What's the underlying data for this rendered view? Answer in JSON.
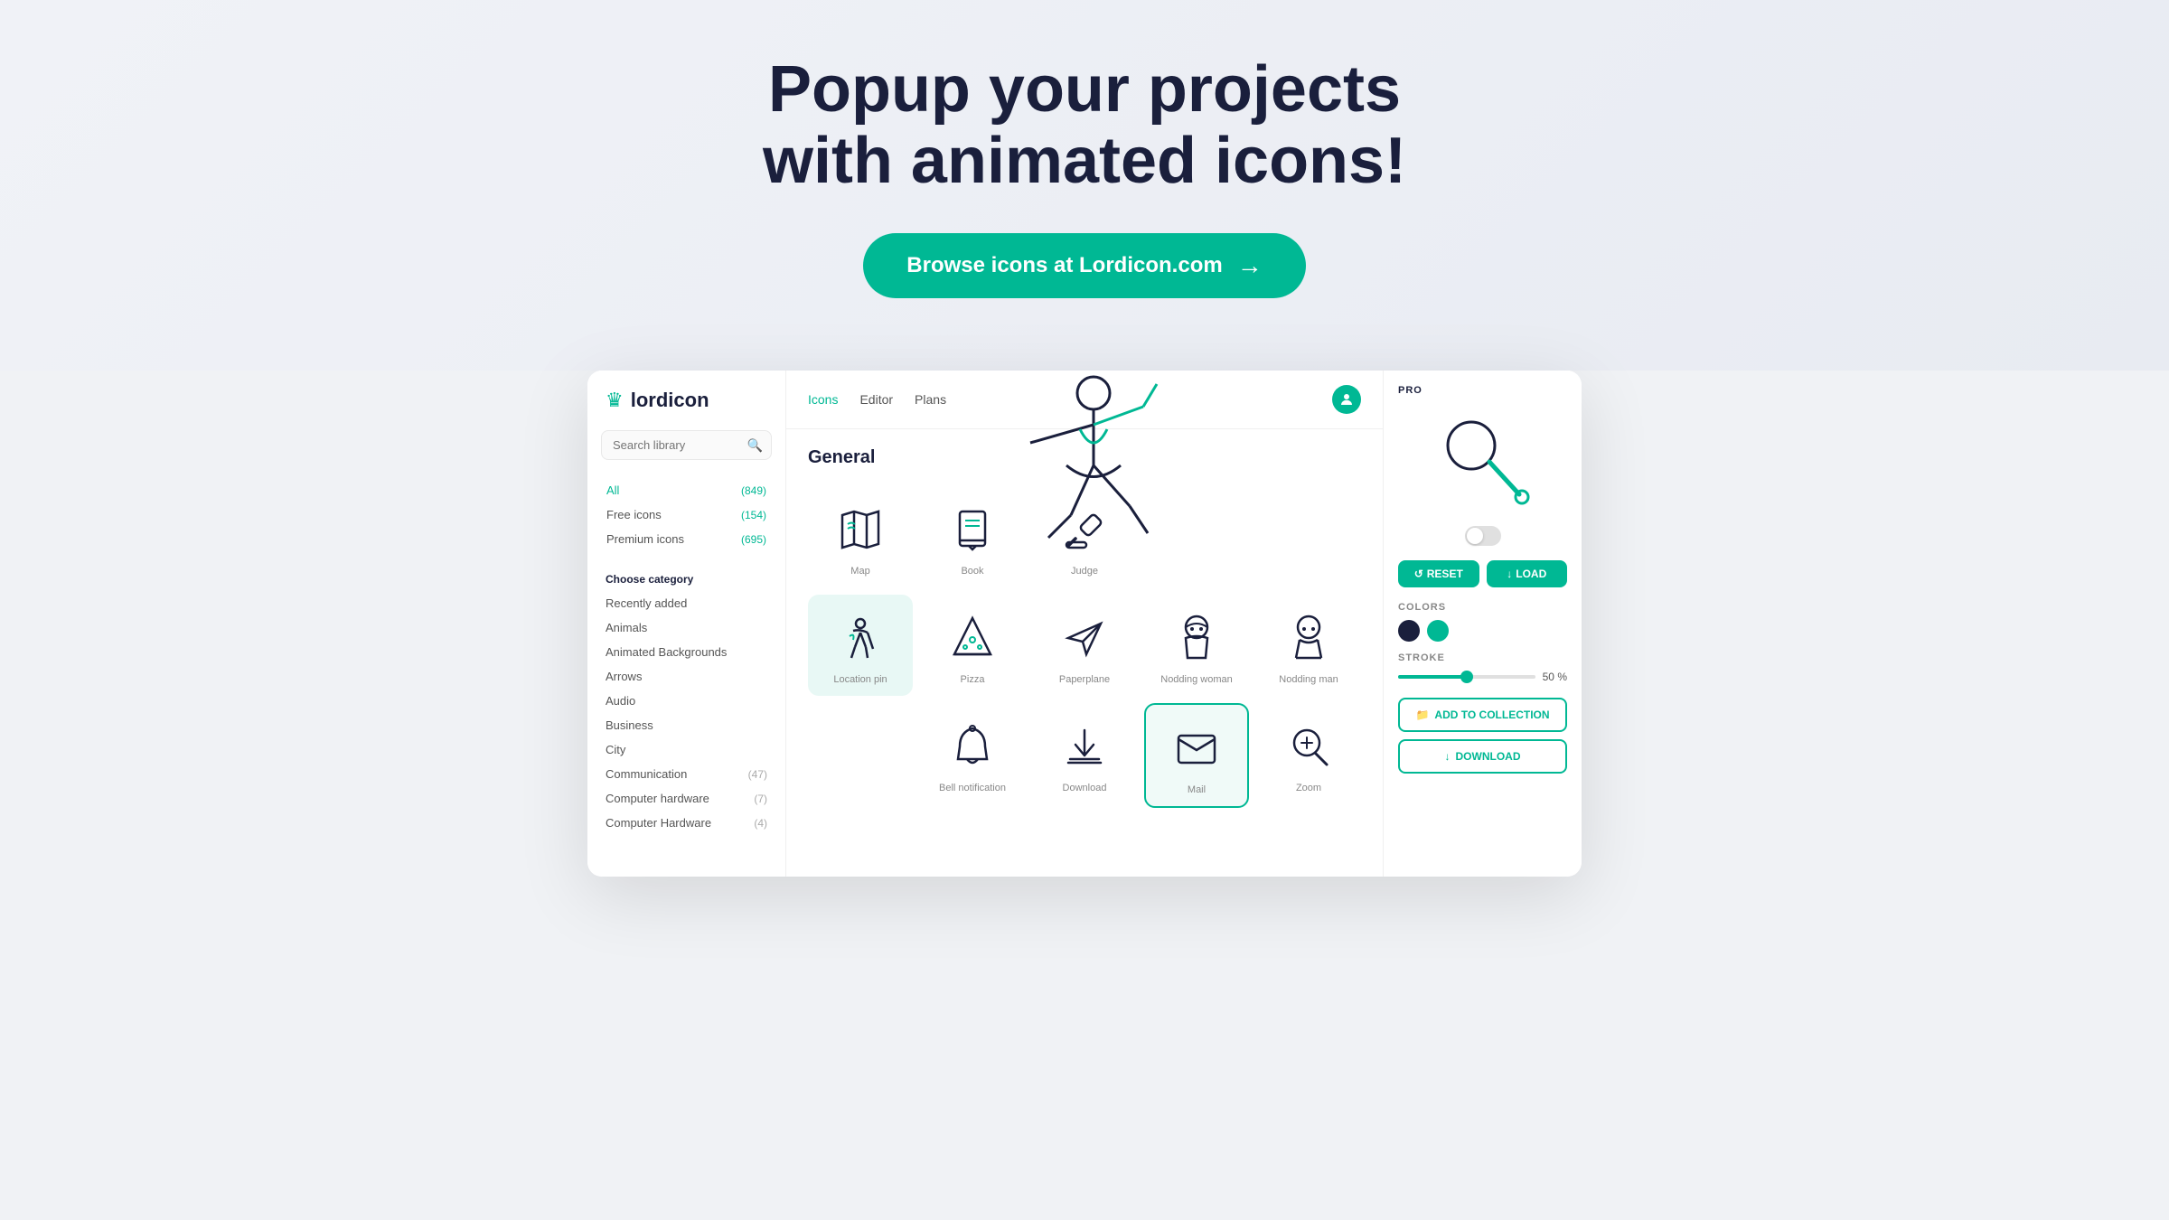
{
  "hero": {
    "title_line1": "Popup your projects",
    "title_line2": "with animated icons!",
    "cta_label": "Browse icons at Lordicon.com",
    "cta_arrow": "→"
  },
  "nav": {
    "logo_text": "lordicon",
    "links": [
      {
        "label": "Icons",
        "active": true
      },
      {
        "label": "Editor",
        "active": false
      },
      {
        "label": "Plans",
        "active": false
      }
    ]
  },
  "sidebar": {
    "search_placeholder": "Search library",
    "filters": [
      {
        "label": "All",
        "count": "(849)",
        "active": true
      },
      {
        "label": "Free icons",
        "count": "(154)",
        "active": false
      },
      {
        "label": "Premium icons",
        "count": "(695)",
        "active": false
      }
    ],
    "category_label": "Choose category",
    "categories": [
      {
        "label": "Recently added",
        "count": ""
      },
      {
        "label": "Animals",
        "count": ""
      },
      {
        "label": "Animated Backgrounds",
        "count": ""
      },
      {
        "label": "Arrows",
        "count": ""
      },
      {
        "label": "Audio",
        "count": ""
      },
      {
        "label": "Business",
        "count": ""
      },
      {
        "label": "City",
        "count": ""
      },
      {
        "label": "Communication",
        "count": "(47)"
      },
      {
        "label": "Computer hardware",
        "count": "(7)"
      },
      {
        "label": "Computer Hardware",
        "count": "(4)"
      }
    ]
  },
  "main": {
    "section_title": "General",
    "icons": [
      {
        "label": "Map",
        "id": "map"
      },
      {
        "label": "Book",
        "id": "book"
      },
      {
        "label": "Judge",
        "id": "judge"
      },
      {
        "label": "",
        "id": "empty1"
      },
      {
        "label": "",
        "id": "empty2"
      },
      {
        "label": "Location pin",
        "id": "location-pin"
      },
      {
        "label": "Pizza",
        "id": "pizza"
      },
      {
        "label": "Paperplane",
        "id": "paperplane"
      },
      {
        "label": "Nodding woman",
        "id": "nodding-woman"
      },
      {
        "label": "Nodding man",
        "id": "nodding-man"
      },
      {
        "label": "",
        "id": "empty3"
      },
      {
        "label": "Bell notification",
        "id": "bell"
      },
      {
        "label": "Download",
        "id": "download"
      },
      {
        "label": "Mail",
        "id": "mail"
      },
      {
        "label": "Zoom",
        "id": "zoom"
      }
    ]
  },
  "right_panel": {
    "pro_label": "PRO",
    "reset_label": "RESET",
    "load_label": "LOAD",
    "colors_title": "COLORS",
    "color1": "#1a1f3c",
    "color2": "#00b894",
    "stroke_title": "STROKE",
    "stroke_value": "50",
    "stroke_unit": "%",
    "add_collection_label": "ADD TO COLLECTION",
    "download_label": "DOWNLOAD"
  }
}
